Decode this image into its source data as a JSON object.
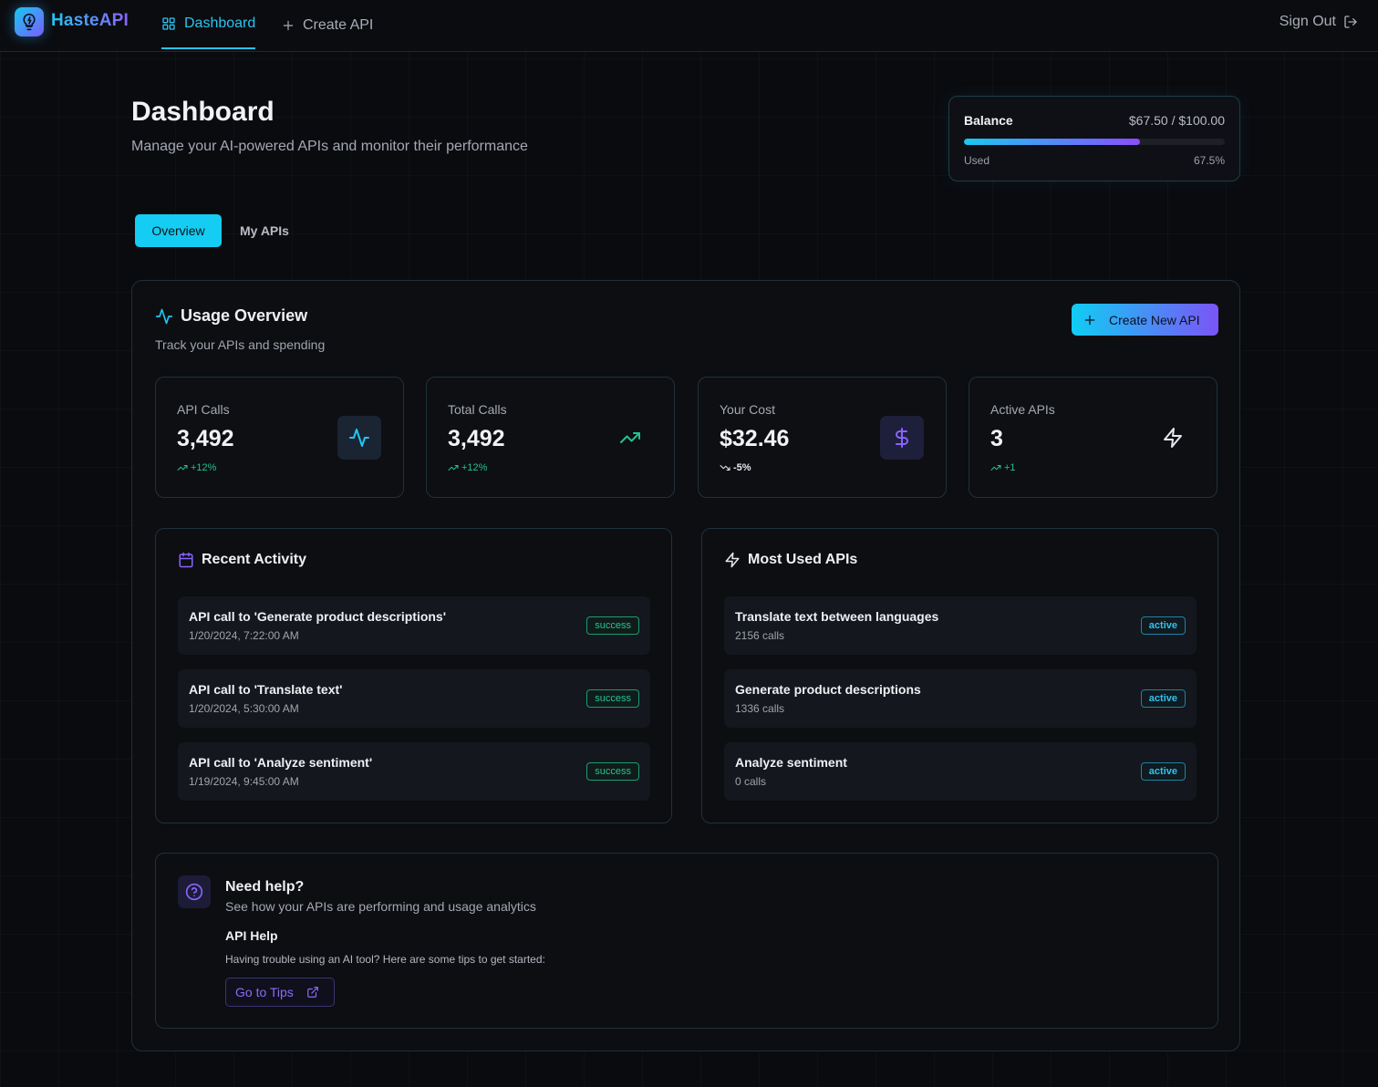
{
  "nav": {
    "brand": "HasteAPI",
    "links": [
      {
        "label": "Dashboard",
        "active": true,
        "icon": "grid-icon"
      },
      {
        "label": "Create API",
        "active": false,
        "icon": "plus-icon"
      }
    ],
    "sign_out": "Sign Out"
  },
  "header": {
    "title": "Dashboard",
    "subtitle": "Manage your AI-powered APIs and monitor their performance"
  },
  "balance": {
    "title": "Balance",
    "value": "$67.50 / $100.00",
    "used_label": "Used",
    "used_percent": "67.5%",
    "fill_fraction": 0.675
  },
  "tabs": [
    {
      "label": "Overview",
      "active": true
    },
    {
      "label": "My APIs",
      "active": false
    }
  ],
  "usage": {
    "title": "Usage Overview",
    "subtitle": "Track your APIs and spending",
    "create_button": "Create New API"
  },
  "stats": [
    {
      "label": "API Calls",
      "value": "3,492",
      "trend": "+12%",
      "direction": "up",
      "icon": "activity-icon"
    },
    {
      "label": "Total Calls",
      "value": "3,492",
      "trend": "+12%",
      "direction": "up",
      "icon": "trending-up-icon"
    },
    {
      "label": "Your Cost",
      "value": "$32.46",
      "trend": "-5%",
      "direction": "down",
      "icon": "dollar-icon"
    },
    {
      "label": "Active APIs",
      "value": "3",
      "trend": "+1",
      "direction": "up",
      "icon": "zap-icon"
    }
  ],
  "recent_activity": {
    "title": "Recent Activity",
    "items": [
      {
        "title": "API call to 'Generate product descriptions'",
        "time": "1/20/2024, 7:22:00 AM",
        "status": "success"
      },
      {
        "title": "API call to 'Translate text'",
        "time": "1/20/2024, 5:30:00 AM",
        "status": "success"
      },
      {
        "title": "API call to 'Analyze sentiment'",
        "time": "1/19/2024, 9:45:00 AM",
        "status": "success"
      }
    ]
  },
  "most_used": {
    "title": "Most Used APIs",
    "items": [
      {
        "title": "Translate text between languages",
        "calls": "2156 calls",
        "status": "active"
      },
      {
        "title": "Generate product descriptions",
        "calls": "1336 calls",
        "status": "active"
      },
      {
        "title": "Analyze sentiment",
        "calls": "0 calls",
        "status": "active"
      }
    ]
  },
  "help": {
    "title": "Need help?",
    "subtitle": "See how your APIs are performing and usage analytics",
    "heading": "API Help",
    "text": "Having trouble using an AI tool? Here are some tips to get started:",
    "button": "Go to Tips"
  },
  "colors": {
    "accent_cyan": "#15cdf2",
    "accent_purple": "#7b54f6",
    "success_green": "#27c392",
    "background": "#0a0b0f"
  }
}
